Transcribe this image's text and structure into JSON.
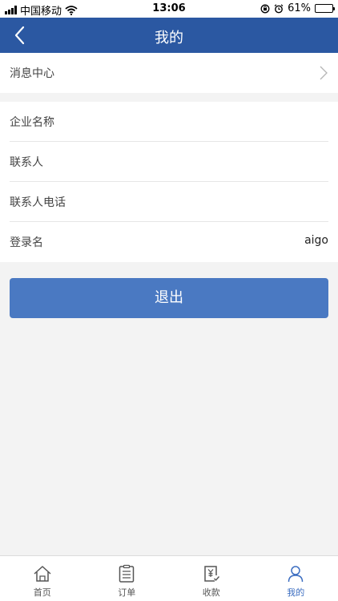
{
  "status_bar": {
    "carrier": "中国移动",
    "time": "13:06",
    "battery": "61%",
    "battery_level": 0.61
  },
  "nav": {
    "title": "我的"
  },
  "message_center": {
    "label": "消息中心"
  },
  "profile": {
    "rows": [
      {
        "label": "企业名称",
        "value": ""
      },
      {
        "label": "联系人",
        "value": ""
      },
      {
        "label": "联系人电话",
        "value": ""
      },
      {
        "label": "登录名",
        "value": "aigo"
      }
    ]
  },
  "logout_label": "退出",
  "tabs": [
    {
      "label": "首页",
      "icon": "home-icon",
      "active": false
    },
    {
      "label": "订单",
      "icon": "order-icon",
      "active": false
    },
    {
      "label": "收款",
      "icon": "payment-icon",
      "active": false
    },
    {
      "label": "我的",
      "icon": "user-icon",
      "active": true
    }
  ],
  "colors": {
    "nav": "#2b58a2",
    "button": "#4a79c2",
    "active_tab": "#3a6cc0"
  }
}
